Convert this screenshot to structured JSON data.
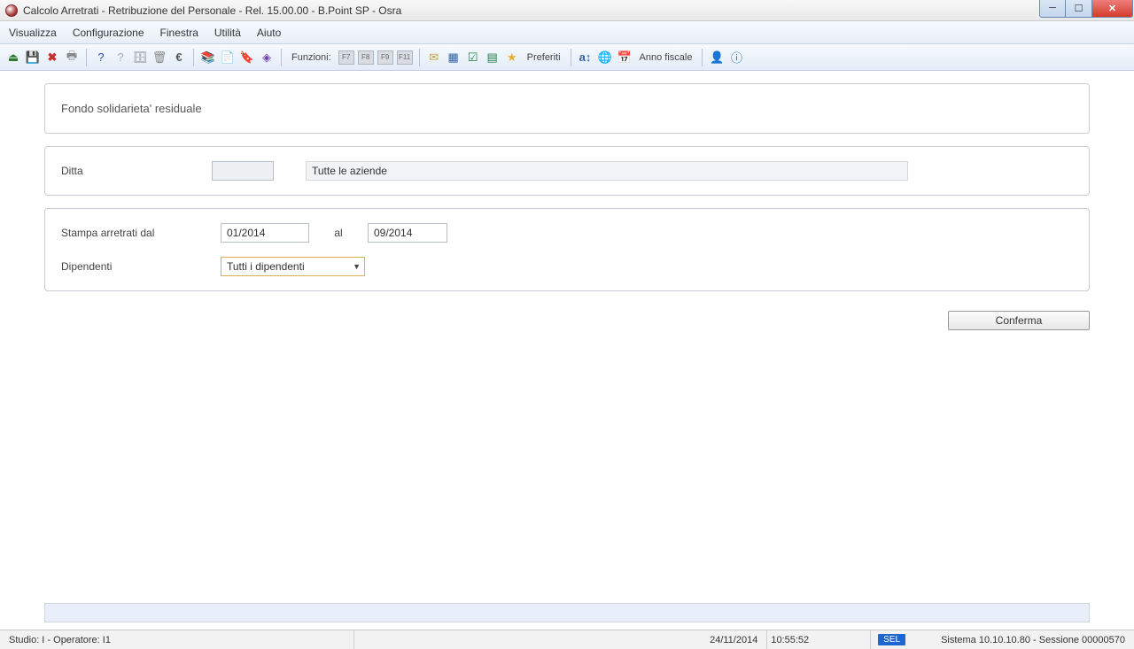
{
  "title": "Calcolo Arretrati - Retribuzione del Personale - Rel. 15.00.00 - B.Point SP - Osra",
  "menu": {
    "m1": "Visualizza",
    "m2": "Configurazione",
    "m3": "Finestra",
    "m4": "Utilità",
    "m5": "Aiuto"
  },
  "toolbar": {
    "funzioni": "Funzioni:",
    "f7": "F7",
    "f8": "F8",
    "f9": "F9",
    "f11": "F11",
    "preferiti": "Preferiti",
    "anno": "Anno fiscale"
  },
  "panel_title": "Fondo solidarieta' residuale",
  "form": {
    "ditta_label": "Ditta",
    "ditta_value": "",
    "ditta_desc": "Tutte le aziende",
    "stampa_label": "Stampa arretrati dal",
    "date_from": "01/2014",
    "al_label": "al",
    "date_to": "09/2014",
    "dip_label": "Dipendenti",
    "dip_value": "Tutti i dipendenti"
  },
  "confirm": "Conferma",
  "status": {
    "left": "Studio: I - Operatore: I1",
    "date": "24/11/2014",
    "time": "10:55:52",
    "sel": "SEL",
    "right": "Sistema 10.10.10.80 - Sessione 00000570"
  }
}
